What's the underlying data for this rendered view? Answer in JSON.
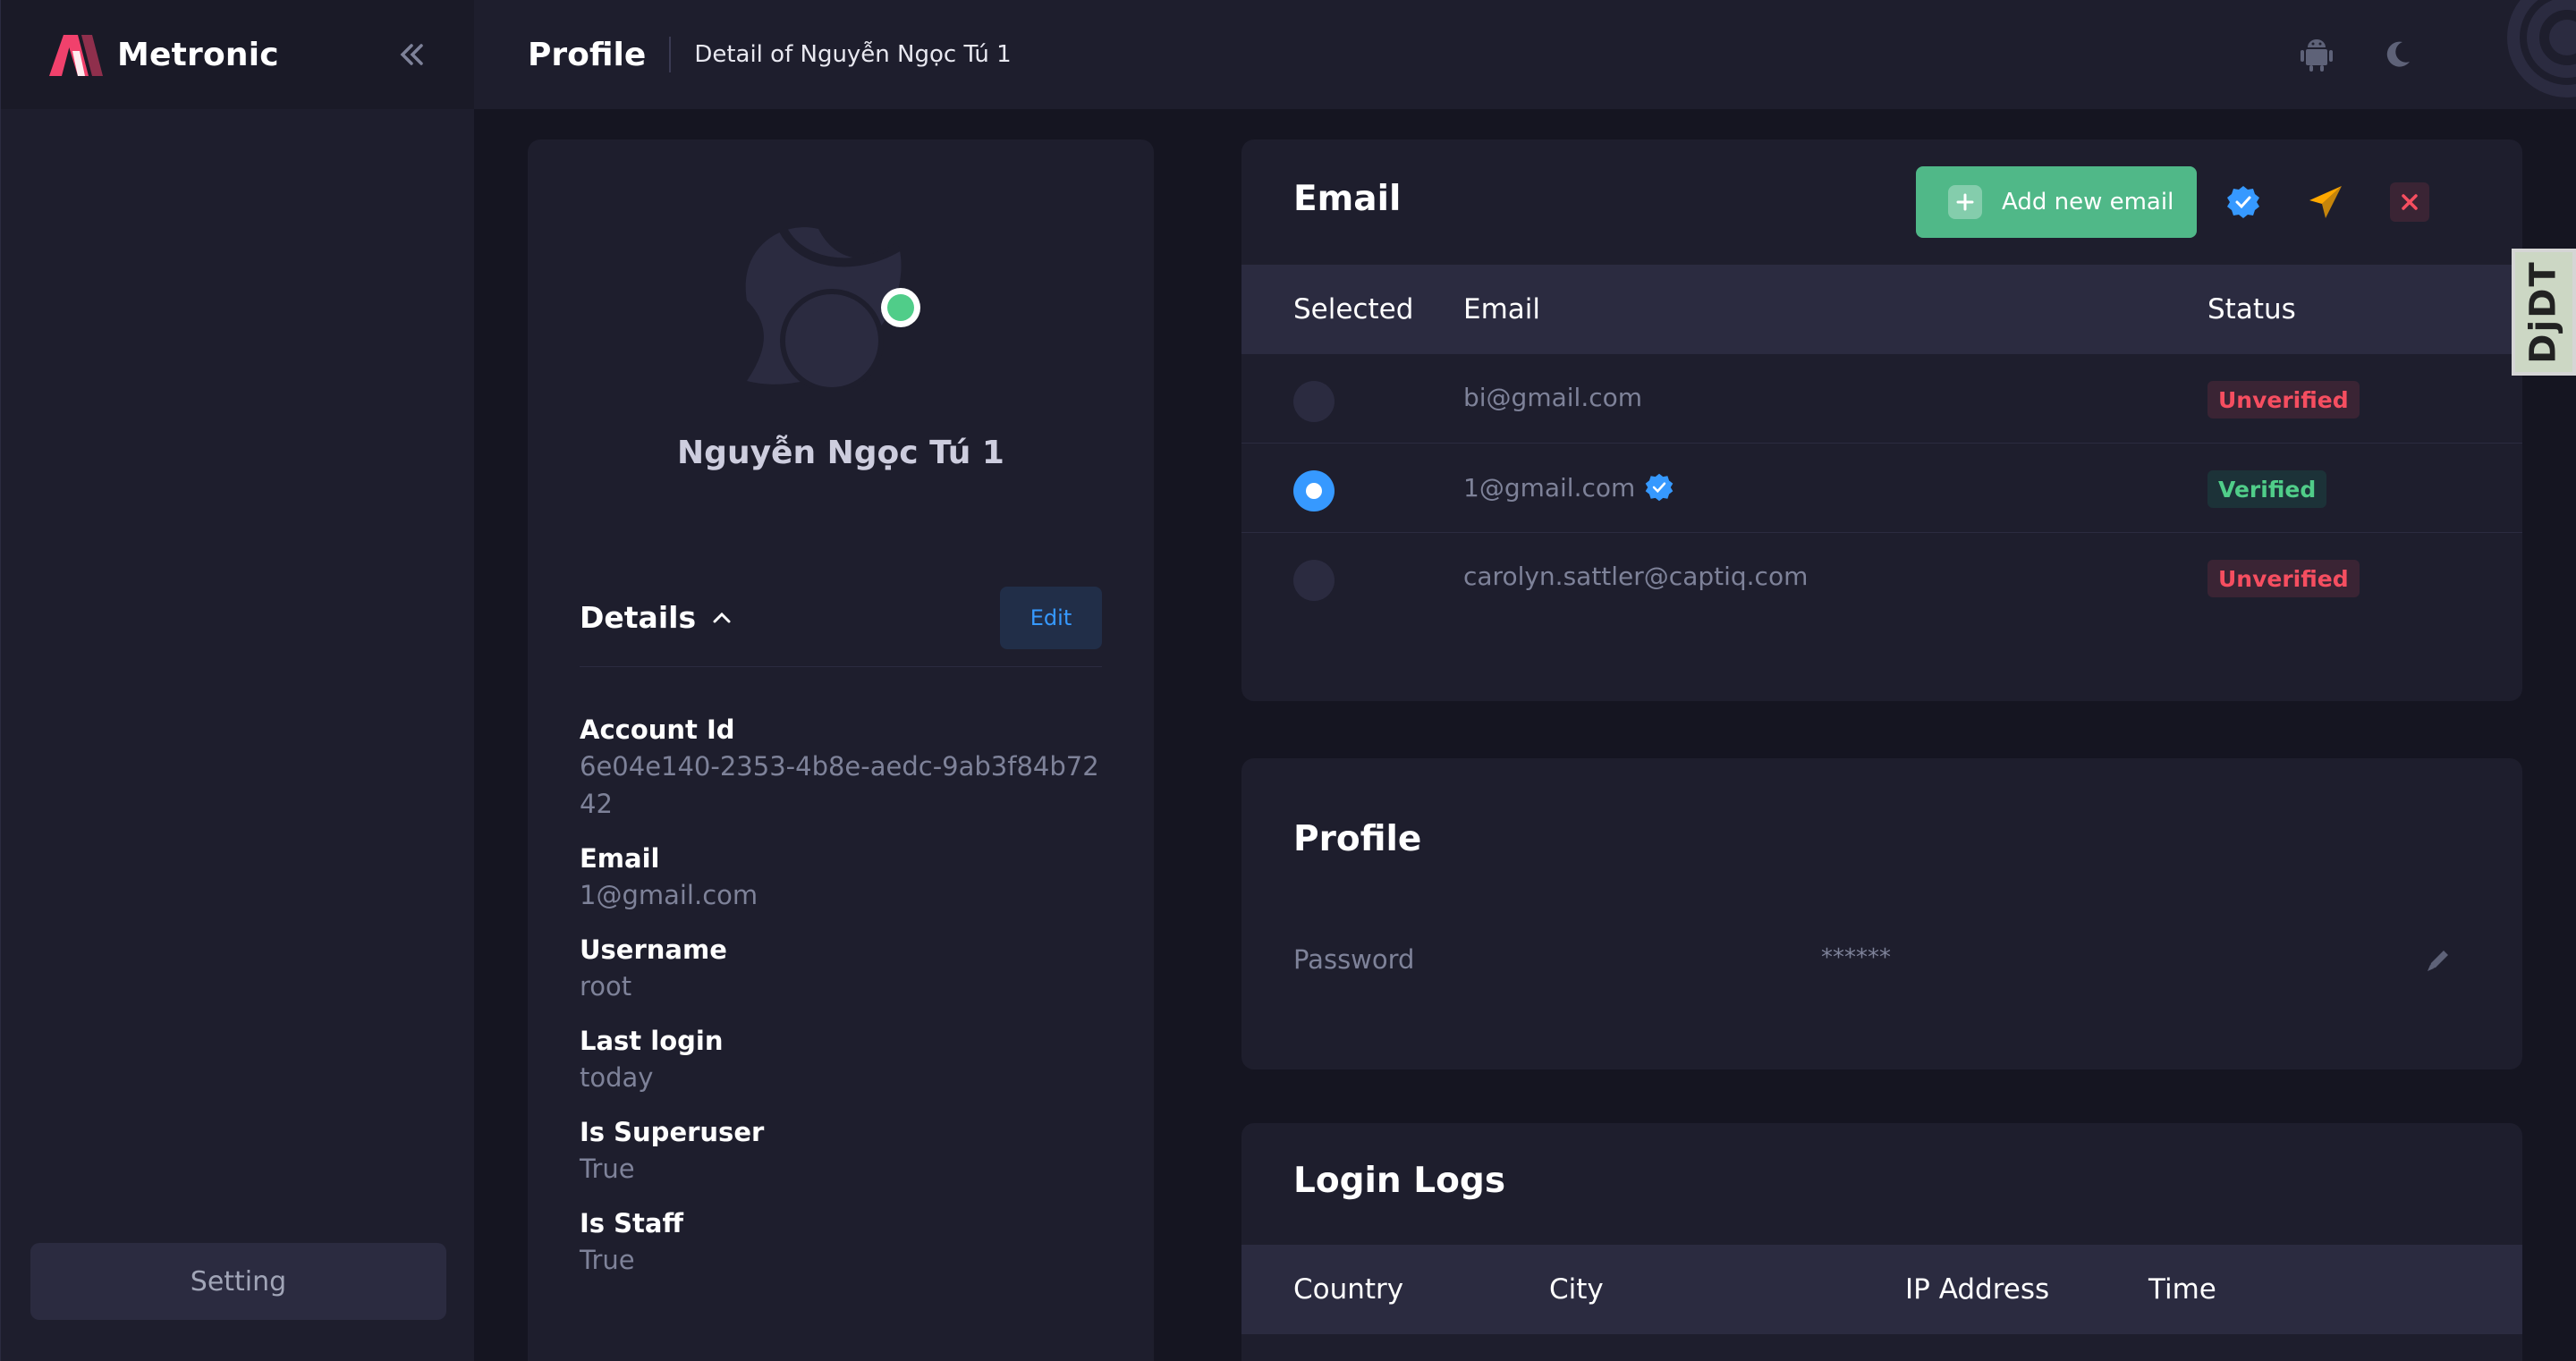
{
  "sidebar": {
    "brand": "Metronic",
    "setting_label": "Setting"
  },
  "topbar": {
    "title": "Profile",
    "subtitle": "Detail of Nguyễn Ngọc Tú 1"
  },
  "user": {
    "name": "Nguyễn Ngọc Tú 1",
    "online_status_color": "#50cd89"
  },
  "details": {
    "title": "Details",
    "edit_label": "Edit",
    "items": [
      {
        "label": "Account Id",
        "value": "6e04e140-2353-4b8e-aedc-9ab3f84b7242"
      },
      {
        "label": "Email",
        "value": "1@gmail.com"
      },
      {
        "label": "Username",
        "value": "root"
      },
      {
        "label": "Last login",
        "value": "today"
      },
      {
        "label": "Is Superuser",
        "value": "True"
      },
      {
        "label": "Is Staff",
        "value": "True"
      }
    ]
  },
  "email_section": {
    "title": "Email",
    "add_label": "Add new email",
    "columns": [
      "Selected",
      "Email",
      "Status"
    ],
    "rows": [
      {
        "email": "bi@gmail.com",
        "selected": false,
        "status": "Unverified",
        "verified_icon": false
      },
      {
        "email": "1@gmail.com",
        "selected": true,
        "status": "Verified",
        "verified_icon": true
      },
      {
        "email": "carolyn.sattler@captiq.com",
        "selected": false,
        "status": "Unverified",
        "verified_icon": false
      }
    ]
  },
  "profile_section": {
    "title": "Profile",
    "password_label": "Password",
    "password_value": "******"
  },
  "login_logs": {
    "title": "Login Logs",
    "columns": [
      "Country",
      "City",
      "IP Address",
      "Time"
    ]
  },
  "debug_toolbar": {
    "label": "DjDT"
  },
  "colors": {
    "background": "#151521",
    "card": "#1e1e2d",
    "primary": "#3699ff",
    "success": "#50cd89",
    "danger": "#f64e60",
    "warning": "#ffa800"
  }
}
